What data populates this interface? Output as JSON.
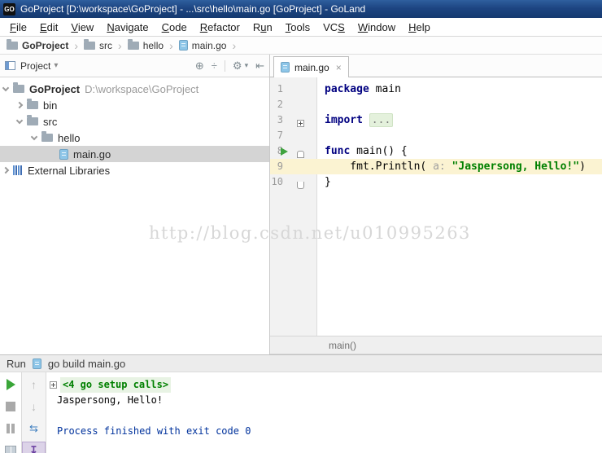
{
  "title_bar": {
    "app_icon_text": "GO",
    "title": "GoProject [D:\\workspace\\GoProject] - ...\\src\\hello\\main.go [GoProject] - GoLand"
  },
  "menu": {
    "items": [
      {
        "pre": "",
        "u": "F",
        "post": "ile"
      },
      {
        "pre": "",
        "u": "E",
        "post": "dit"
      },
      {
        "pre": "",
        "u": "V",
        "post": "iew"
      },
      {
        "pre": "",
        "u": "N",
        "post": "avigate"
      },
      {
        "pre": "",
        "u": "C",
        "post": "ode"
      },
      {
        "pre": "",
        "u": "R",
        "post": "efactor"
      },
      {
        "pre": "R",
        "u": "u",
        "post": "n"
      },
      {
        "pre": "",
        "u": "T",
        "post": "ools"
      },
      {
        "pre": "VC",
        "u": "S",
        "post": ""
      },
      {
        "pre": "",
        "u": "W",
        "post": "indow"
      },
      {
        "pre": "",
        "u": "H",
        "post": "elp"
      }
    ]
  },
  "breadcrumbs": {
    "sep": "›",
    "items": [
      {
        "label": "GoProject"
      },
      {
        "label": "src"
      },
      {
        "label": "hello"
      },
      {
        "label": "main.go"
      }
    ]
  },
  "project_panel": {
    "header": {
      "title": "Project",
      "caret": "▾",
      "icons": {
        "locate": "⊕",
        "collapse": "÷",
        "gear": "⚙",
        "gear_caret": "▾",
        "hide": "⇤"
      }
    },
    "tree": [
      {
        "label": "GoProject",
        "path": "D:\\workspace\\GoProject"
      },
      {
        "label": "bin"
      },
      {
        "label": "src"
      },
      {
        "label": "hello"
      },
      {
        "label": "main.go"
      },
      {
        "label": "External Libraries"
      }
    ]
  },
  "editor": {
    "tab": {
      "label": "main.go",
      "close": "×"
    },
    "lines": {
      "l1": {
        "num": "1",
        "kw": "package",
        "rest": " main"
      },
      "l2": {
        "num": "2"
      },
      "l3": {
        "num": "3",
        "kw": "import",
        "fold": "..."
      },
      "l7": {
        "num": "7"
      },
      "l8": {
        "num": "8",
        "kw": "func",
        "rest": " main() {"
      },
      "l9": {
        "num": "9",
        "pre": "    fmt.Println(",
        "hint": "a:",
        "str": "\"Jaspersong, Hello!\"",
        "post": ")"
      },
      "l10": {
        "num": "10",
        "rest": "}"
      }
    },
    "breadcrumb": "main()"
  },
  "run_panel": {
    "header": {
      "label": "Run",
      "task": "go build main.go"
    },
    "toolbar": {
      "up": "↑",
      "down": "↓",
      "rerun": "⇆",
      "scroll": "↧"
    },
    "console": {
      "setup_calls": "<4 go setup calls>",
      "output": "Jaspersong, Hello!",
      "exit": "Process finished with exit code 0"
    }
  },
  "watermark": {
    "text": "http://blog.csdn.net/u010995263"
  },
  "colors": {
    "keyword": "#000080",
    "string": "#008000",
    "exit_text": "#00329c",
    "title_bar": "#1d4582",
    "current_line": "#fbf3d2"
  }
}
